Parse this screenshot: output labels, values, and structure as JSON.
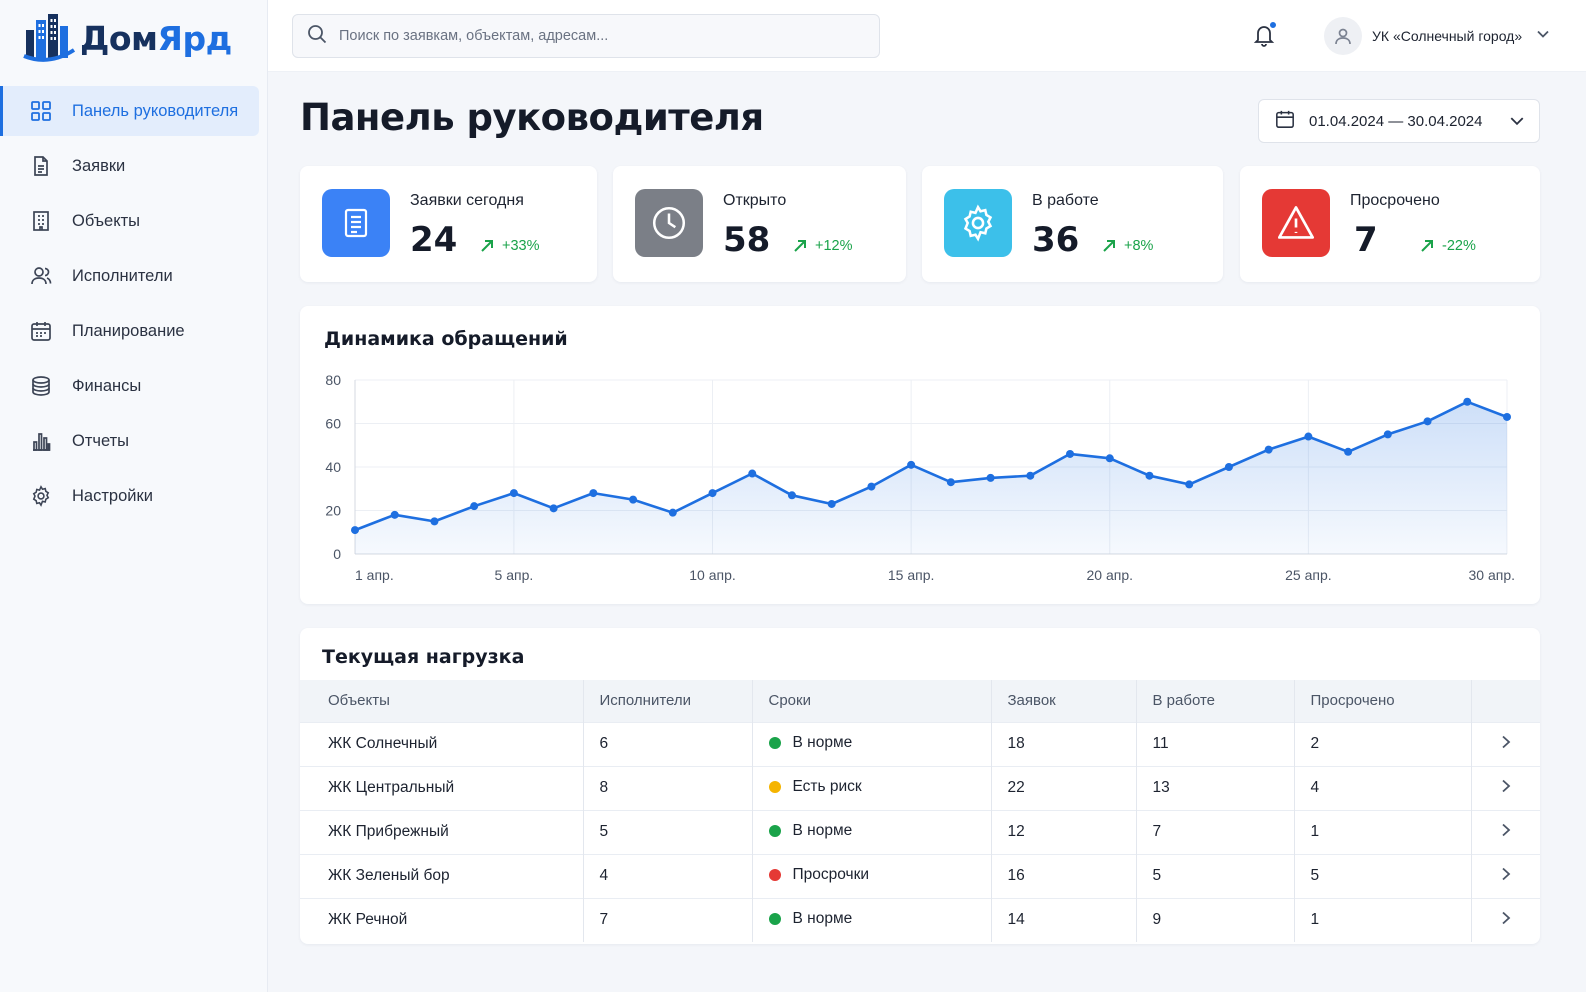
{
  "brand": {
    "part1": "Дом",
    "part2": "Ярд",
    "primary": "#1e6fe0",
    "dark": "#16315e"
  },
  "sidebar": {
    "items": [
      {
        "label": "Панель руководителя",
        "icon": "grid-icon",
        "active": true
      },
      {
        "label": "Заявки",
        "icon": "document-icon"
      },
      {
        "label": "Объекты",
        "icon": "building-icon"
      },
      {
        "label": "Исполнители",
        "icon": "users-icon"
      },
      {
        "label": "Планирование",
        "icon": "calendar-icon"
      },
      {
        "label": "Финансы",
        "icon": "database-icon"
      },
      {
        "label": "Отчеты",
        "icon": "bar-chart-icon"
      },
      {
        "label": "Настройки",
        "icon": "gear-icon"
      }
    ]
  },
  "topbar": {
    "search_placeholder": "Поиск по заявкам, объектам, адресам...",
    "user_name": "УК «Солнечный город»",
    "has_notification": true
  },
  "main": {
    "title": "Панель руководителя",
    "date_range": "01.04.2024 — 30.04.2024"
  },
  "kpis": [
    {
      "label": "Заявки сегодня",
      "value": "24",
      "delta": "+33%",
      "color": "#3b82f6",
      "icon": "document-icon"
    },
    {
      "label": "Открыто",
      "value": "58",
      "delta": "+12%",
      "color": "#7b7f87",
      "icon": "clock-icon"
    },
    {
      "label": "В работе",
      "value": "36",
      "delta": "+8%",
      "color": "#3cc0ea",
      "icon": "gear-icon"
    },
    {
      "label": "Просрочено",
      "value": "7",
      "delta": "-22%",
      "color": "#e53935",
      "icon": "warning-icon"
    }
  ],
  "chart_title": "Динамика обращений",
  "chart_data": {
    "type": "area",
    "title": "Динамика обращений",
    "x": [
      1,
      2,
      3,
      4,
      5,
      6,
      7,
      8,
      9,
      10,
      11,
      12,
      13,
      14,
      15,
      16,
      17,
      18,
      19,
      20,
      21,
      22,
      23,
      24,
      25,
      26,
      27,
      28,
      29,
      30
    ],
    "x_ticks": [
      1,
      5,
      10,
      15,
      20,
      25,
      30
    ],
    "x_tick_labels": [
      "1 апр.",
      "5 апр.",
      "10 апр.",
      "15 апр.",
      "20 апр.",
      "25 апр.",
      "30 апр."
    ],
    "y": [
      11,
      18,
      15,
      22,
      28,
      21,
      28,
      25,
      19,
      28,
      37,
      27,
      23,
      31,
      41,
      33,
      35,
      36,
      46,
      44,
      36,
      32,
      40,
      48,
      54,
      47,
      55,
      61,
      70,
      63
    ],
    "ylim": [
      0,
      80
    ],
    "y_ticks": [
      0,
      20,
      40,
      60,
      80
    ],
    "grid": true,
    "color": "#1e6fe0"
  },
  "load": {
    "title": "Текущая нагрузка",
    "columns": [
      "Объекты",
      "Исполнители",
      "Сроки",
      "Заявок",
      "В работе",
      "Просрочено"
    ],
    "rows": [
      {
        "object": "ЖК Солнечный",
        "workers": "6",
        "status": "В норме",
        "status_color": "#1aa34a",
        "requests": "18",
        "in_work": "11",
        "overdue": "2"
      },
      {
        "object": "ЖК Центральный",
        "workers": "8",
        "status": "Есть риск",
        "status_color": "#f5b400",
        "requests": "22",
        "in_work": "13",
        "overdue": "4"
      },
      {
        "object": "ЖК Прибрежный",
        "workers": "5",
        "status": "В норме",
        "status_color": "#1aa34a",
        "requests": "12",
        "in_work": "7",
        "overdue": "1"
      },
      {
        "object": "ЖК Зеленый бор",
        "workers": "4",
        "status": "Просрочки",
        "status_color": "#e53935",
        "requests": "16",
        "in_work": "5",
        "overdue": "5"
      },
      {
        "object": "ЖК Речной",
        "workers": "7",
        "status": "В норме",
        "status_color": "#1aa34a",
        "requests": "14",
        "in_work": "9",
        "overdue": "1"
      }
    ]
  }
}
